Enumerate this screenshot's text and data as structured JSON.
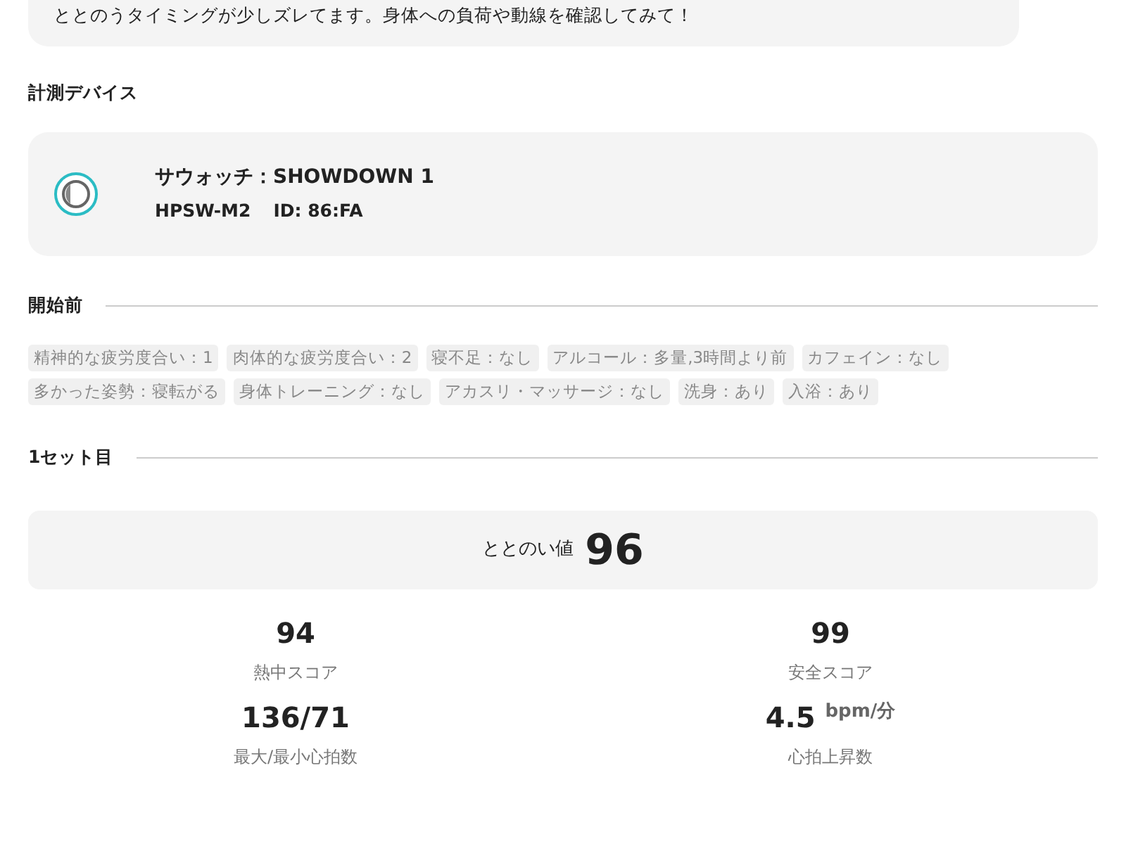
{
  "comment_bubble": {
    "text": "ととのうタイミングが少しズレてます。身体への負荷や動線を確認してみて！"
  },
  "device_section": {
    "title": "計測デバイス",
    "device": {
      "name": "サウォッチ：SHOWDOWN 1",
      "model": "HPSW-M2",
      "id": "ID: 86:FA"
    }
  },
  "before_section": {
    "title": "開始前",
    "tags": [
      "精神的な疲労度合い：1",
      "肉体的な疲労度合い：2",
      "寝不足：なし",
      "アルコール：多量,3時間より前",
      "カフェイン：なし",
      "多かった姿勢：寝転がる",
      "身体トレーニング：なし",
      "アカスリ・マッサージ：なし",
      "洗身：あり",
      "入浴：あり"
    ]
  },
  "set_section": {
    "title": "1セット目",
    "score_label": "ととのい値",
    "score": "96",
    "stats": [
      {
        "value": "94",
        "label": "熱中スコア"
      },
      {
        "value": "99",
        "label": "安全スコア"
      },
      {
        "value": "136/71",
        "label": "最大/最小心拍数"
      },
      {
        "value": "4.5",
        "unit": "bpm/分",
        "label": "心拍上昇数"
      }
    ]
  }
}
